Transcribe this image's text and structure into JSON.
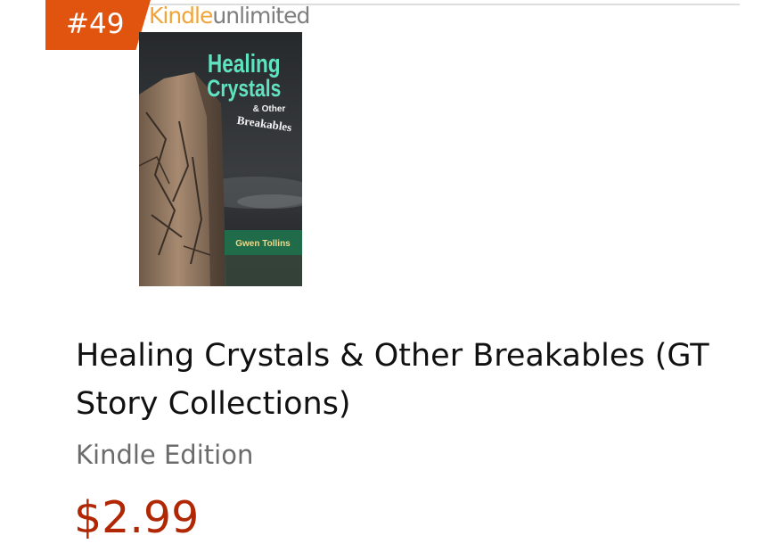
{
  "rank": "#49",
  "program": {
    "part1": "Kindle",
    "part2": "unlimited"
  },
  "cover": {
    "title_line1": "Healing",
    "title_line2": "Crystals",
    "subtitle_line1": "& Other",
    "subtitle_line2": "Breakables",
    "author": "Gwen Tollins"
  },
  "product": {
    "title": "Healing Crystals & Other Breakables (GT Story Collections)",
    "format": "Kindle Edition",
    "price": "$2.99"
  },
  "colors": {
    "badge": "#e1540f",
    "price": "#b12704",
    "cover_title": "#5fe3c0",
    "cover_author_band": "#1f6b4a"
  }
}
